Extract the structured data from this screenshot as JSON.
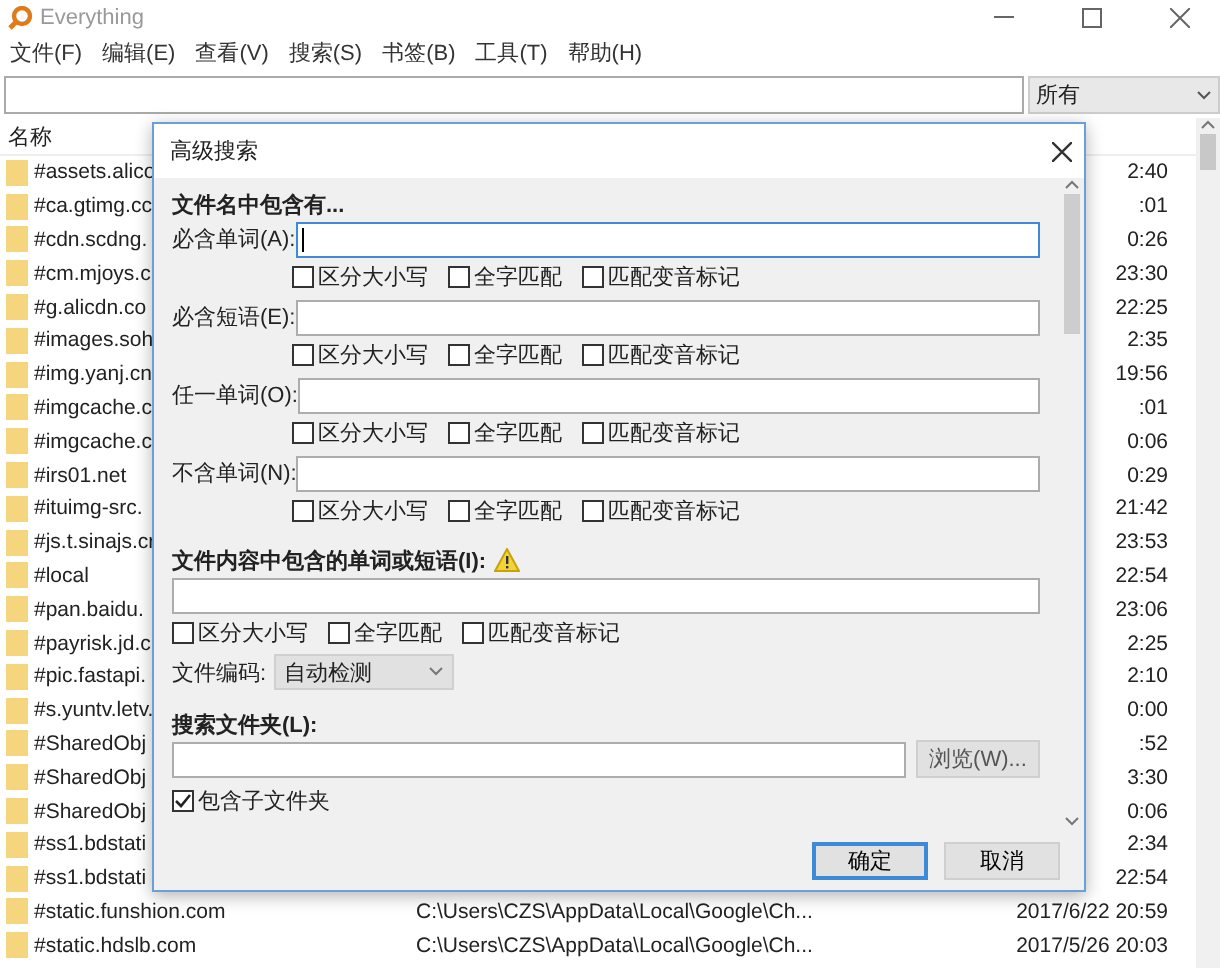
{
  "window": {
    "title": "Everything"
  },
  "menu": [
    "文件(F)",
    "编辑(E)",
    "查看(V)",
    "搜索(S)",
    "书签(B)",
    "工具(T)",
    "帮助(H)"
  ],
  "search": {
    "filter": "所有"
  },
  "list": {
    "columns": [
      "名称"
    ],
    "rows": [
      {
        "name": "#assets.alico",
        "time": "2:40"
      },
      {
        "name": "#ca.gtimg.cc",
        "time": ":01"
      },
      {
        "name": "#cdn.scdng.",
        "time": "0:26"
      },
      {
        "name": "#cm.mjoys.c",
        "time": "23:30"
      },
      {
        "name": "#g.alicdn.co",
        "time": "22:25"
      },
      {
        "name": "#images.soh",
        "time": "2:35"
      },
      {
        "name": "#img.yanj.cn",
        "time": "19:56"
      },
      {
        "name": "#imgcache.c",
        "time": ":01"
      },
      {
        "name": "#imgcache.c",
        "time": "0:06"
      },
      {
        "name": "#irs01.net",
        "time": "0:29"
      },
      {
        "name": "#ituimg-src.",
        "time": "21:42"
      },
      {
        "name": "#js.t.sinajs.cr",
        "time": "23:53"
      },
      {
        "name": "#local",
        "time": "22:54"
      },
      {
        "name": "#pan.baidu.",
        "time": "23:06"
      },
      {
        "name": "#payrisk.jd.c",
        "time": "2:25"
      },
      {
        "name": "#pic.fastapi.",
        "time": "2:10"
      },
      {
        "name": "#s.yuntv.letv.",
        "time": "0:00"
      },
      {
        "name": "#SharedObj",
        "time": ":52"
      },
      {
        "name": "#SharedObj",
        "time": "3:30"
      },
      {
        "name": "#SharedObj",
        "time": "0:06"
      },
      {
        "name": "#ss1.bdstati",
        "time": "2:34"
      },
      {
        "name": "#ss1.bdstati",
        "time": "22:54"
      },
      {
        "name": "#static.funshion.com",
        "path": "C:\\Users\\CZS\\AppData\\Local\\Google\\Ch...",
        "time": "2017/6/22 20:59"
      },
      {
        "name": "#static.hdslb.com",
        "path": "C:\\Users\\CZS\\AppData\\Local\\Google\\Ch...",
        "time": "2017/5/26 20:03"
      }
    ]
  },
  "dialog": {
    "title": "高级搜索",
    "filename_section": {
      "heading": "文件名中包含有...",
      "fields": [
        {
          "label": "必含单词(A):",
          "focused": true,
          "options": [
            {
              "label": "区分大小写",
              "checked": false
            },
            {
              "label": "全字匹配",
              "checked": false
            },
            {
              "label": "匹配变音标记",
              "checked": false
            }
          ]
        },
        {
          "label": "必含短语(E):",
          "focused": false,
          "options": [
            {
              "label": "区分大小写",
              "checked": false
            },
            {
              "label": "全字匹配",
              "checked": false
            },
            {
              "label": "匹配变音标记",
              "checked": false
            }
          ]
        },
        {
          "label": "任一单词(O):",
          "focused": false,
          "options": [
            {
              "label": "区分大小写",
              "checked": false
            },
            {
              "label": "全字匹配",
              "checked": false
            },
            {
              "label": "匹配变音标记",
              "checked": false
            }
          ]
        },
        {
          "label": "不含单词(N):",
          "focused": false,
          "options": [
            {
              "label": "区分大小写",
              "checked": false
            },
            {
              "label": "全字匹配",
              "checked": false
            },
            {
              "label": "匹配变音标记",
              "checked": false
            }
          ]
        }
      ]
    },
    "content_section": {
      "heading": "文件内容中包含的单词或短语(I):",
      "options": [
        {
          "label": "区分大小写",
          "checked": false
        },
        {
          "label": "全字匹配",
          "checked": false
        },
        {
          "label": "匹配变音标记",
          "checked": false
        }
      ],
      "encoding_label": "文件编码:",
      "encoding": "自动检测"
    },
    "folder_section": {
      "heading": "搜索文件夹(L):",
      "browse": "浏览(W)...",
      "subfolders": {
        "label": "包含子文件夹",
        "checked": true
      }
    },
    "buttons": [
      {
        "label": "确定",
        "default": true
      },
      {
        "label": "取消",
        "default": false
      }
    ]
  }
}
